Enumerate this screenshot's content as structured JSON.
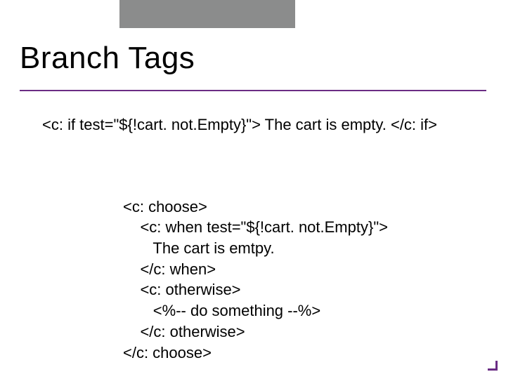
{
  "slide": {
    "title": "Branch Tags",
    "if_line": "<c: if test=\"${!cart. not.Empty}\"> The cart is empty. </c: if>",
    "code_lines": [
      "<c: choose>",
      "    <c: when test=\"${!cart. not.Empty}\">",
      "       The cart is emtpy.",
      "    </c: when>",
      "    <c: otherwise>",
      "       <%-- do something --%>",
      "    </c: otherwise>",
      "</c: choose>"
    ]
  }
}
